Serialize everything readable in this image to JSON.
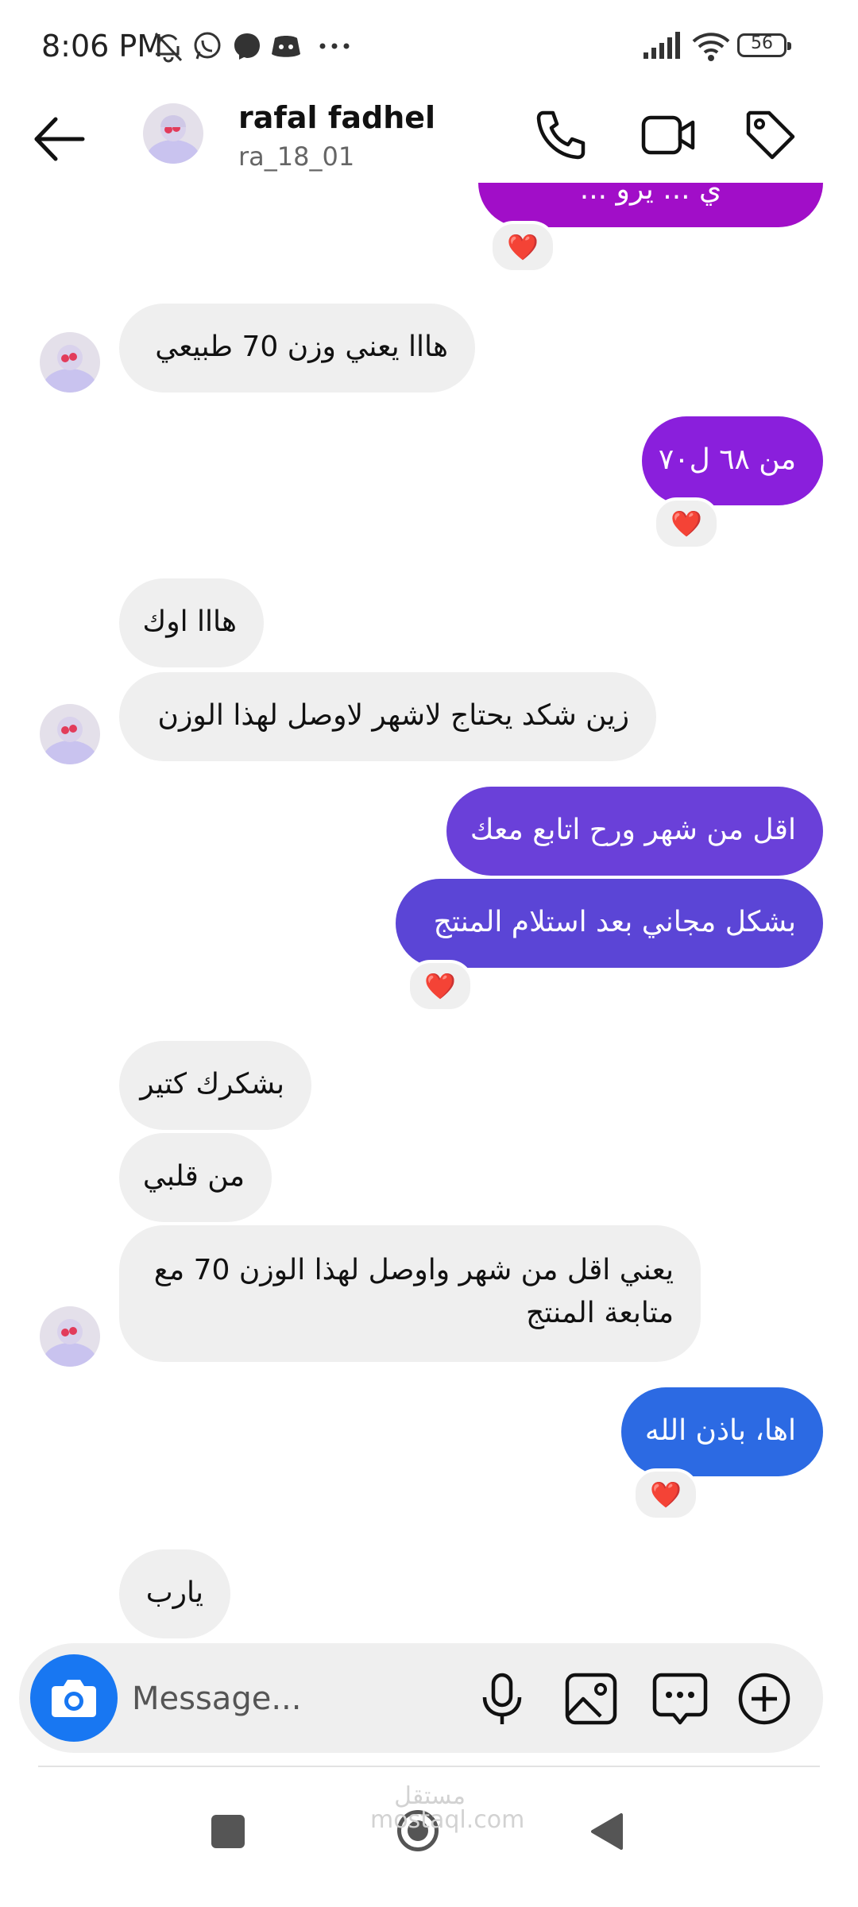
{
  "status_bar": {
    "time": "8:06 PM",
    "left_icons": [
      "bell-off-icon",
      "whatsapp-icon",
      "messenger-icon",
      "discord-icon",
      "more-dots-icon"
    ],
    "right_icons": [
      "signal-icon",
      "wifi-icon",
      "battery-icon"
    ],
    "battery": "56"
  },
  "header": {
    "name": "rafal fadhel",
    "handle": "ra_18_01",
    "icons": [
      "back-arrow-icon",
      "phone-icon",
      "video-camera-icon",
      "tag-icon"
    ]
  },
  "messages": [
    {
      "id": "m0",
      "side": "out",
      "text": "ي ... يرو ...",
      "reaction": "❤️"
    },
    {
      "id": "m1",
      "side": "in",
      "text": "هااا يعني وزن 70 طبيعي"
    },
    {
      "id": "m2",
      "side": "out",
      "text": "من ٦٨ ل٧٠",
      "reaction": "❤️"
    },
    {
      "id": "m3",
      "side": "in",
      "text": "هااا اوك"
    },
    {
      "id": "m4",
      "side": "in",
      "text": "زين شكد يحتاج لاشهر لاوصل لهذا الوزن"
    },
    {
      "id": "m5",
      "side": "out",
      "text": "اقل من شهر ورح اتابع معك"
    },
    {
      "id": "m6",
      "side": "out",
      "text": "بشكل مجاني بعد استلام المنتج",
      "reaction": "❤️"
    },
    {
      "id": "m7",
      "side": "in",
      "text": "بشكرك كتير"
    },
    {
      "id": "m8",
      "side": "in",
      "text": "من قلبي"
    },
    {
      "id": "m9",
      "side": "in",
      "text": "يعني اقل من شهر واوصل لهذا الوزن 70 مع متابعة المنتج"
    },
    {
      "id": "m10",
      "side": "out",
      "text": "اها، باذن الله",
      "reaction": "❤️"
    },
    {
      "id": "m11",
      "side": "in",
      "text": "يارب"
    }
  ],
  "composer": {
    "placeholder": "Message...",
    "icons": [
      "camera-icon",
      "microphone-icon",
      "gallery-icon",
      "sticker-chat-icon",
      "add-icon"
    ]
  },
  "nav_bar": {
    "icons": [
      "recents-square-icon",
      "home-circle-icon",
      "back-triangle-icon"
    ]
  },
  "watermark": "مستقل\nmostaql.com",
  "colors": {
    "gradient_purple": "#a10ec8",
    "bubble_violet": "#7b2fd9",
    "bubble_indigo": "#5b45d6",
    "bubble_blue": "#2c6ae3",
    "incoming": "#efefef"
  }
}
